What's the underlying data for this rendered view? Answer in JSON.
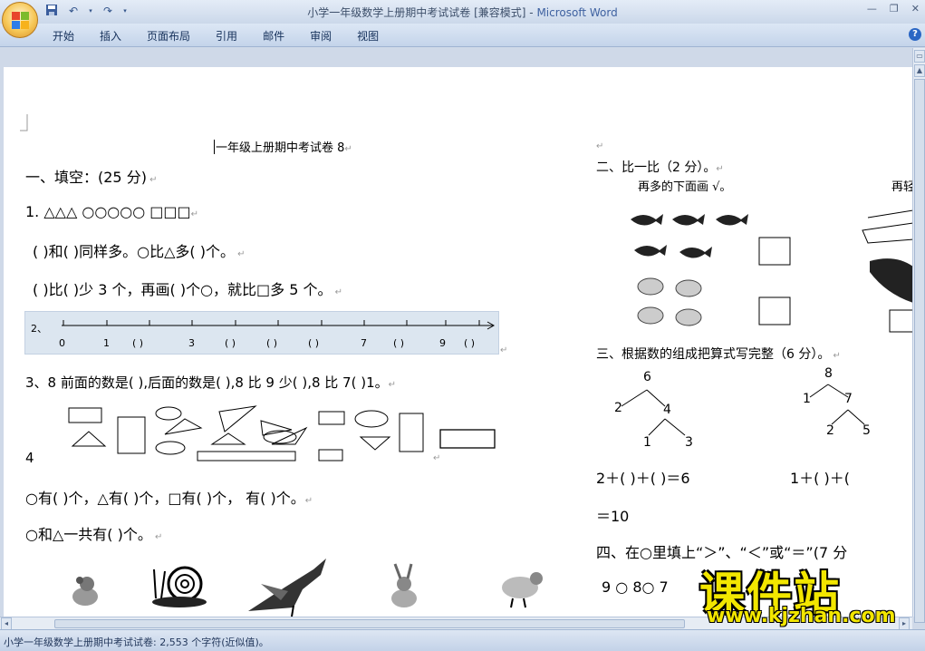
{
  "window": {
    "doc_title": "小学一年级数学上册期中考试试卷 [兼容模式]",
    "separator": " - ",
    "app_name": "Microsoft Word",
    "minimize": "—",
    "restore": "❐",
    "close": "✕"
  },
  "ribbon": {
    "tabs": [
      "开始",
      "插入",
      "页面布局",
      "引用",
      "邮件",
      "审阅",
      "视图"
    ],
    "help": "?"
  },
  "doc": {
    "title": "一年级上册期中考试卷 8",
    "s1_heading": "一、填空：(25 分)",
    "q1_shapes": "1.  △△△   ○○○○○    □□□",
    "q1_line_a": "(     )和(     )同样多。○比△多(     )个。",
    "q1_line_b": "(     )比(     )少 3 个，再画(    )个○，就比□多 5 个。",
    "numberline": {
      "qnum": "2、",
      "labels": [
        "0",
        "1",
        "(  )",
        "3",
        "(  )",
        "(  )",
        "(  )",
        "7",
        "(  )",
        "9",
        "(  )"
      ]
    },
    "q3": "3、8 前面的数是(    ),后面的数是(    ),8 比 9 少(    ),8 比 7(   )1。",
    "q4_num": "4",
    "q4_line_a": "○有(  )个，△有(  )个，□有(    )个，        有(    )个。",
    "q4_line_b": "○和△一共有(     )个。",
    "s2_heading": "二、比一比（2 分）。",
    "s2_instruction": "再多的下面画 √。",
    "s2_cut": "再轻",
    "s3_heading": "三、根据数的组成把算式写完整（6 分）。",
    "tree1": {
      "top": "6",
      "left": "2",
      "mid": "4",
      "bl": "1",
      "br": "3"
    },
    "tree2": {
      "top": "8",
      "left": "1",
      "mid": "7",
      "bl": "2",
      "br": "5"
    },
    "eq1": "2＋(  )＋(  )＝6",
    "eq2": "1＋(  )＋(",
    "eq3": "＝10",
    "s4_heading": "四、在○里填上“＞”、“＜”或“＝”(7 分",
    "s4_q": "9 ○ 8○ 7"
  },
  "status": {
    "text": "小学一年级数学上册期中考试试卷: 2,553 个字符(近似值)。"
  },
  "watermark": {
    "main": "课件站",
    "url": "www.kjzhan.com"
  },
  "colors": {
    "title_bar": "#d4e0f0",
    "app_name": "#3e61a0",
    "numberline_bg": "#dce6f0",
    "watermark": "#f2e600"
  }
}
